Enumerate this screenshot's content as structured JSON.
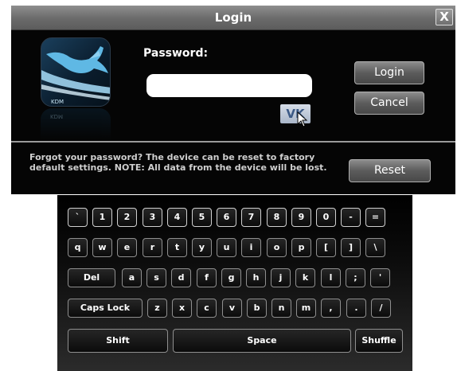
{
  "window": {
    "title": "Login",
    "close_glyph": "X"
  },
  "logo": {
    "text": "KDM"
  },
  "form": {
    "password_label": "Password:",
    "password_value": "",
    "vk_label": "VK"
  },
  "buttons": {
    "login": "Login",
    "cancel": "Cancel",
    "reset": "Reset"
  },
  "forgot_text": "Forgot your password? The device can be reset to factory default settings. NOTE: All data from the device will be lost.",
  "keyboard": {
    "rows": [
      [
        "`",
        "1",
        "2",
        "3",
        "4",
        "5",
        "6",
        "7",
        "8",
        "9",
        "0",
        "-",
        "="
      ],
      [
        "q",
        "w",
        "e",
        "r",
        "t",
        "y",
        "u",
        "i",
        "o",
        "p",
        "[",
        "]",
        "\\"
      ],
      [
        "Del",
        "a",
        "s",
        "d",
        "f",
        "g",
        "h",
        "j",
        "k",
        "l",
        ";",
        "'"
      ],
      [
        "Caps Lock",
        "z",
        "x",
        "c",
        "v",
        "b",
        "n",
        "m",
        ",",
        ".",
        "/"
      ],
      [
        "Shift",
        "Space",
        "Shuffle"
      ]
    ]
  },
  "colors": {
    "window_bg": "#050505",
    "titlebar": "#7a7a7a",
    "vk_text": "#3c5a86"
  }
}
